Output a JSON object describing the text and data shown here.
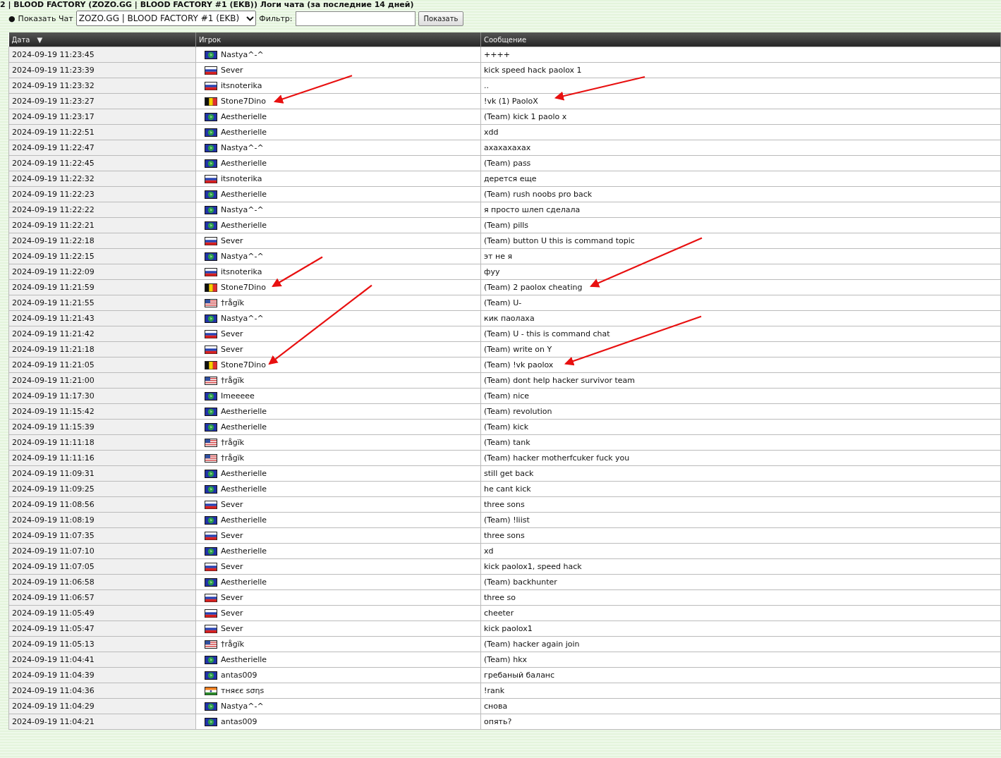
{
  "page_title": "2 | BLOOD FACTORY (ZOZO.GG | BLOOD FACTORY #1 (EKB)) Логи чата (за последние 14 дней)",
  "filter_bar": {
    "bullet": "●",
    "show_chat_label": "Показать Чат",
    "chat_select": "ZOZO.GG | BLOOD FACTORY #1 (EKB)",
    "filter_label": "Фильтр:",
    "show_button": "Показать"
  },
  "table": {
    "columns": [
      {
        "label": "Дата",
        "sort": "▼"
      },
      {
        "label": "Игрок"
      },
      {
        "label": "Сообщение"
      }
    ],
    "rows": [
      {
        "date": "2024-09-19 11:23:45",
        "flag": {
          "kind": "world"
        },
        "player": "Nastya^-^",
        "message": "++++"
      },
      {
        "date": "2024-09-19 11:23:39",
        "flag": {
          "kind": "ru"
        },
        "player": "Sever",
        "message": "kick speed hack paolox 1"
      },
      {
        "date": "2024-09-19 11:23:32",
        "flag": {
          "kind": "ru"
        },
        "player": "itsnoterika",
        "message": ".."
      },
      {
        "date": "2024-09-19 11:23:27",
        "flag": {
          "kind": "be"
        },
        "player": "Stone7Dino",
        "message": "!vk (1) PaoloX"
      },
      {
        "date": "2024-09-19 11:23:17",
        "flag": {
          "kind": "world"
        },
        "player": "Aestherielle",
        "message": "(Team) kick 1 paolo x"
      },
      {
        "date": "2024-09-19 11:22:51",
        "flag": {
          "kind": "world"
        },
        "player": "Aestherielle",
        "message": "xdd"
      },
      {
        "date": "2024-09-19 11:22:47",
        "flag": {
          "kind": "world"
        },
        "player": "Nastya^-^",
        "message": "ахахахахах"
      },
      {
        "date": "2024-09-19 11:22:45",
        "flag": {
          "kind": "world"
        },
        "player": "Aestherielle",
        "message": "(Team) pass"
      },
      {
        "date": "2024-09-19 11:22:32",
        "flag": {
          "kind": "ru"
        },
        "player": "itsnoterika",
        "message": "дерется еще"
      },
      {
        "date": "2024-09-19 11:22:23",
        "flag": {
          "kind": "world"
        },
        "player": "Aestherielle",
        "message": "(Team) rush noobs pro back"
      },
      {
        "date": "2024-09-19 11:22:22",
        "flag": {
          "kind": "world"
        },
        "player": "Nastya^-^",
        "message": "я просто шлеп сделала"
      },
      {
        "date": "2024-09-19 11:22:21",
        "flag": {
          "kind": "world"
        },
        "player": "Aestherielle",
        "message": "(Team) pills"
      },
      {
        "date": "2024-09-19 11:22:18",
        "flag": {
          "kind": "ru"
        },
        "player": "Sever",
        "message": "(Team) button U this is command topic"
      },
      {
        "date": "2024-09-19 11:22:15",
        "flag": {
          "kind": "world"
        },
        "player": "Nastya^-^",
        "message": "эт не я"
      },
      {
        "date": "2024-09-19 11:22:09",
        "flag": {
          "kind": "ru"
        },
        "player": "itsnoterika",
        "message": "фуу"
      },
      {
        "date": "2024-09-19 11:21:59",
        "flag": {
          "kind": "be"
        },
        "player": "Stone7Dino",
        "message": "(Team) 2 paolox cheating"
      },
      {
        "date": "2024-09-19 11:21:55",
        "flag": {
          "kind": "us"
        },
        "player": "†rågïk",
        "message": "(Team) U-"
      },
      {
        "date": "2024-09-19 11:21:43",
        "flag": {
          "kind": "world"
        },
        "player": "Nastya^-^",
        "message": "кик паолаха"
      },
      {
        "date": "2024-09-19 11:21:42",
        "flag": {
          "kind": "ru"
        },
        "player": "Sever",
        "message": "(Team) U - this is command chat"
      },
      {
        "date": "2024-09-19 11:21:18",
        "flag": {
          "kind": "ru"
        },
        "player": "Sever",
        "message": "(Team) write on Y"
      },
      {
        "date": "2024-09-19 11:21:05",
        "flag": {
          "kind": "be"
        },
        "player": "Stone7Dino",
        "message": "(Team) !vk paolox"
      },
      {
        "date": "2024-09-19 11:21:00",
        "flag": {
          "kind": "us"
        },
        "player": "†rågïk",
        "message": "(Team) dont help hacker survivor team"
      },
      {
        "date": "2024-09-19 11:17:30",
        "flag": {
          "kind": "world"
        },
        "player": "Imeeeee",
        "message": "(Team) nice"
      },
      {
        "date": "2024-09-19 11:15:42",
        "flag": {
          "kind": "world"
        },
        "player": "Aestherielle",
        "message": "(Team) revolution"
      },
      {
        "date": "2024-09-19 11:15:39",
        "flag": {
          "kind": "world"
        },
        "player": "Aestherielle",
        "message": "(Team) kick"
      },
      {
        "date": "2024-09-19 11:11:18",
        "flag": {
          "kind": "us"
        },
        "player": "†rågïk",
        "message": "(Team) tank"
      },
      {
        "date": "2024-09-19 11:11:16",
        "flag": {
          "kind": "us"
        },
        "player": "†rågïk",
        "message": "(Team) hacker motherfcuker fuck you"
      },
      {
        "date": "2024-09-19 11:09:31",
        "flag": {
          "kind": "world"
        },
        "player": "Aestherielle",
        "message": "still get back"
      },
      {
        "date": "2024-09-19 11:09:25",
        "flag": {
          "kind": "world"
        },
        "player": "Aestherielle",
        "message": "he cant kick"
      },
      {
        "date": "2024-09-19 11:08:56",
        "flag": {
          "kind": "ru"
        },
        "player": "Sever",
        "message": "three sons"
      },
      {
        "date": "2024-09-19 11:08:19",
        "flag": {
          "kind": "world"
        },
        "player": "Aestherielle",
        "message": "(Team) !liist"
      },
      {
        "date": "2024-09-19 11:07:35",
        "flag": {
          "kind": "ru"
        },
        "player": "Sever",
        "message": "three sons"
      },
      {
        "date": "2024-09-19 11:07:10",
        "flag": {
          "kind": "world"
        },
        "player": "Aestherielle",
        "message": "xd"
      },
      {
        "date": "2024-09-19 11:07:05",
        "flag": {
          "kind": "ru"
        },
        "player": "Sever",
        "message": "kick paolox1, speed hack"
      },
      {
        "date": "2024-09-19 11:06:58",
        "flag": {
          "kind": "world"
        },
        "player": "Aestherielle",
        "message": "(Team) backhunter"
      },
      {
        "date": "2024-09-19 11:06:57",
        "flag": {
          "kind": "ru"
        },
        "player": "Sever",
        "message": "three so"
      },
      {
        "date": "2024-09-19 11:05:49",
        "flag": {
          "kind": "ru"
        },
        "player": "Sever",
        "message": "cheeter"
      },
      {
        "date": "2024-09-19 11:05:47",
        "flag": {
          "kind": "ru"
        },
        "player": "Sever",
        "message": "kick paolox1"
      },
      {
        "date": "2024-09-19 11:05:13",
        "flag": {
          "kind": "us"
        },
        "player": "†rågïk",
        "message": "(Team) hacker again join"
      },
      {
        "date": "2024-09-19 11:04:41",
        "flag": {
          "kind": "world"
        },
        "player": "Aestherielle",
        "message": "(Team) hkx"
      },
      {
        "date": "2024-09-19 11:04:39",
        "flag": {
          "kind": "world"
        },
        "player": "antas009",
        "message": "гребаный баланс"
      },
      {
        "date": "2024-09-19 11:04:36",
        "flag": {
          "kind": "in"
        },
        "player": "тняєє ѕσηѕ",
        "message": "!rank"
      },
      {
        "date": "2024-09-19 11:04:29",
        "flag": {
          "kind": "world"
        },
        "player": "Nastya^-^",
        "message": "снова"
      },
      {
        "date": "2024-09-19 11:04:21",
        "flag": {
          "kind": "world"
        },
        "player": "antas009",
        "message": "опять?"
      }
    ]
  }
}
